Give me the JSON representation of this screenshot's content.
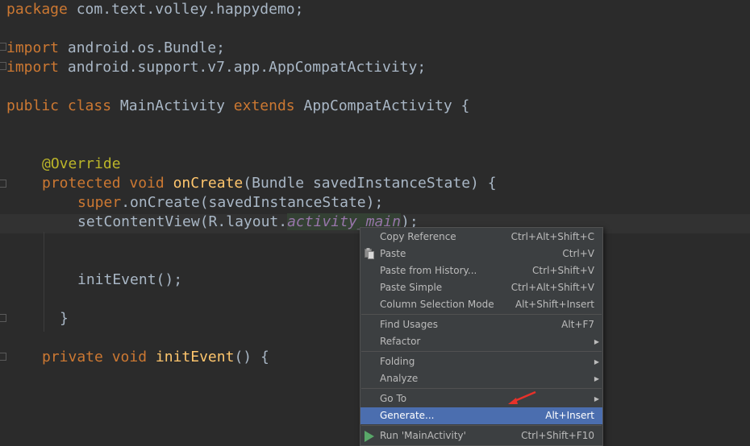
{
  "code": {
    "l1_kw": "package ",
    "l1_rest": "com.text.volley.happydemo;",
    "l2_kw": "import ",
    "l2_rest": "android.os.Bundle;",
    "l3_kw": "import ",
    "l3_rest": "android.support.v7.app.AppCompatActivity;",
    "l4_kw1": "public class ",
    "l4_name": "MainActivity ",
    "l4_kw2": "extends ",
    "l4_rest": "AppCompatActivity {",
    "l5_ann": "@Override",
    "l6_kw": "protected void ",
    "l6_fn": "onCreate",
    "l6_rest": "(Bundle savedInstanceState) {",
    "l7_kw": "super",
    "l7_rest": ".onCreate(savedInstanceState);",
    "l8_a": "setContentView(R.layout.",
    "l8_fld": "activity_main",
    "l8_b": ");",
    "l9": "initEvent();",
    "l10": "}",
    "l11_kw": "private void ",
    "l11_fn": "initEvent",
    "l11_rest": "() {"
  },
  "menu": {
    "copy_ref": "Copy Reference",
    "copy_ref_sc": "Ctrl+Alt+Shift+C",
    "paste": "Paste",
    "paste_sc": "Ctrl+V",
    "paste_hist": "Paste from History...",
    "paste_hist_sc": "Ctrl+Shift+V",
    "paste_simple": "Paste Simple",
    "paste_simple_sc": "Ctrl+Alt+Shift+V",
    "col_sel": "Column Selection Mode",
    "col_sel_sc": "Alt+Shift+Insert",
    "find_usages": "Find Usages",
    "find_usages_sc": "Alt+F7",
    "refactor": "Refactor",
    "folding": "Folding",
    "analyze": "Analyze",
    "goto": "Go To",
    "generate": "Generate...",
    "generate_sc": "Alt+Insert",
    "run": "Run 'MainActivity'",
    "run_sc": "Ctrl+Shift+F10"
  },
  "colors": {
    "background": "#2b2b2b",
    "keyword": "#cc7832",
    "method": "#ffc66d",
    "annotation": "#bbb529",
    "field": "#9876aa",
    "menu_selected": "#4b6eaf",
    "annotation_arrow": "#e8312a"
  },
  "icons": [
    "paste-icon",
    "run-icon",
    "submenu-arrow-icon",
    "red-arrow-annotation"
  ]
}
